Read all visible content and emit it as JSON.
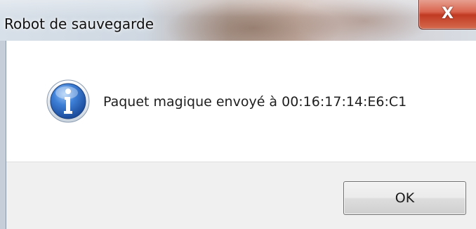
{
  "window": {
    "title": "Robot de sauvegarde",
    "close_glyph": "X",
    "close_icon": "close-icon"
  },
  "dialog": {
    "icon": "info-icon",
    "message": "Paquet magique envoyé à 00:16:17:14:E6:C1",
    "ok_label": "OK"
  },
  "colors": {
    "close_button": "#c13a22",
    "info_icon": "#2f6fc4",
    "button_bar": "#f0f0f0"
  }
}
